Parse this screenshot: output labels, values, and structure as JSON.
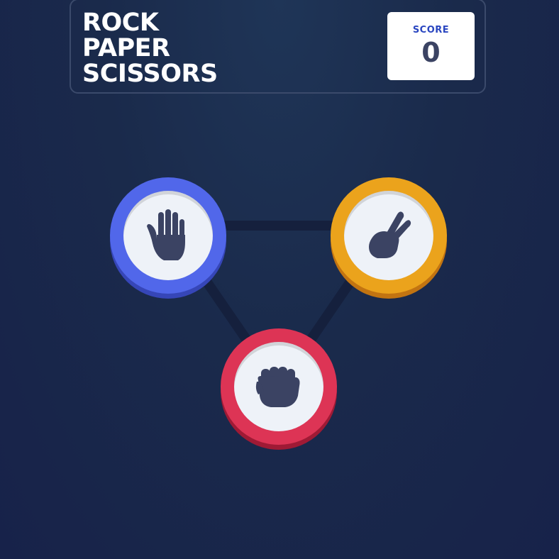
{
  "header": {
    "title_lines": [
      "ROCK",
      "PAPER",
      "SCISSORS"
    ],
    "score_label": "SCORE",
    "score_value": "0"
  },
  "choices": [
    {
      "id": "paper",
      "icon": "hand-open-icon",
      "color": "#5167ea"
    },
    {
      "id": "scissors",
      "icon": "hand-victory-icon",
      "color": "#eba31c"
    },
    {
      "id": "rock",
      "icon": "hand-fist-icon",
      "color": "#dd3455"
    }
  ],
  "colors": {
    "background": "#1a2a4b",
    "icon": "#3b4363",
    "token_face": "#eef2f8"
  }
}
